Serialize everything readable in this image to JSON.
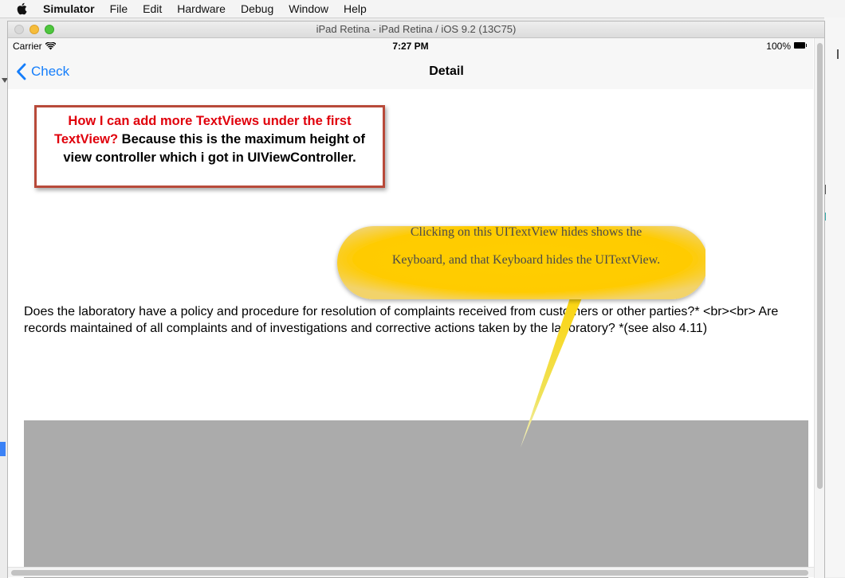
{
  "menubar": {
    "app_name": "Simulator",
    "items": [
      "File",
      "Edit",
      "Hardware",
      "Debug",
      "Window",
      "Help"
    ]
  },
  "window": {
    "title": "iPad Retina - iPad Retina / iOS 9.2 (13C75)"
  },
  "statusbar": {
    "carrier": "Carrier",
    "time": "7:27 PM",
    "battery": "100%"
  },
  "navbar": {
    "back_label": "Check",
    "title": "Detail"
  },
  "annotation": {
    "red_text": "How I can add more TextViews under the first TextView?",
    "black_text": " Because this is the maximum height of view controller which i got in UIViewController."
  },
  "bubble": {
    "line1": "Clicking on this UITextView hides shows the",
    "line2": "Keyboard, and that Keyboard hides the UITextView."
  },
  "question": {
    "text": "Does the laboratory have a policy and procedure for resolution of complaints received from customers or other parties?* <br><br> Are records maintained of all complaints and of investigations and corrective actions taken by the laboratory? *(see also 4.11)"
  },
  "colors": {
    "ios_tint": "#157efb",
    "callout_red": "#e0000b",
    "bubble_yellow": "#ffcc00",
    "textview_gray": "#ababab"
  }
}
